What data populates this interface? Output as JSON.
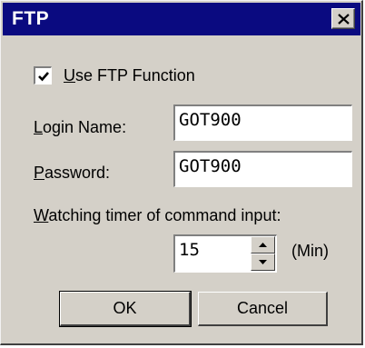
{
  "window": {
    "title": "FTP",
    "close_icon": "close-icon"
  },
  "use_ftp": {
    "checked": true,
    "label": "Use FTP Function",
    "mnemonic": "U",
    "label_rest": "se FTP Function"
  },
  "login": {
    "label": "Login Name:",
    "mnemonic": "L",
    "label_rest": "ogin Name:",
    "value": "GOT900"
  },
  "password": {
    "label": "Password:",
    "mnemonic": "P",
    "label_rest": "assword:",
    "value": "GOT900"
  },
  "watch": {
    "label": "Watching timer of command input:",
    "mnemonic": "W",
    "label_rest": "atching timer of command input:",
    "value": "15",
    "unit": "(Min)"
  },
  "buttons": {
    "ok": "OK",
    "cancel": "Cancel"
  }
}
